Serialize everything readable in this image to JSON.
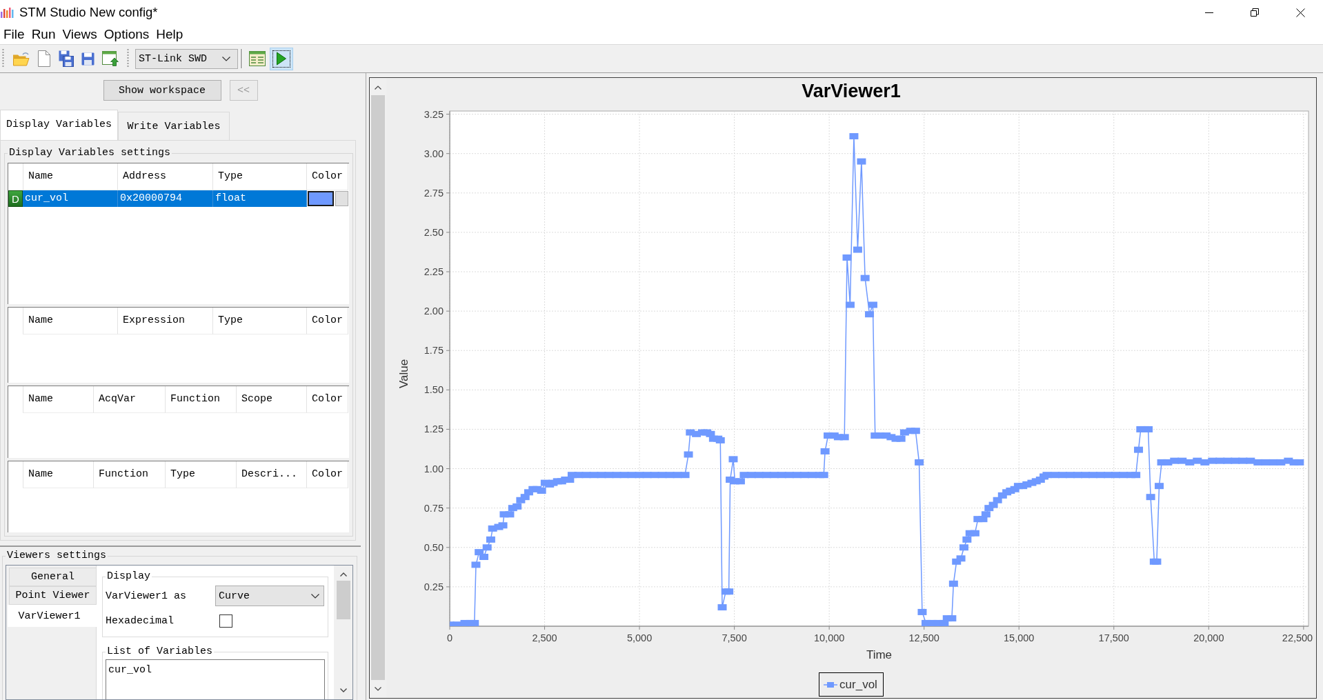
{
  "window": {
    "title": "STM Studio New config*"
  },
  "menu": [
    "File",
    "Run",
    "Views",
    "Options",
    "Help"
  ],
  "toolbar": {
    "connection": "ST-Link SWD",
    "run_focused": true
  },
  "workspace": {
    "show_button": {
      "label": "Show workspace",
      "disabled": false
    },
    "collapse_button": {
      "label": "<<",
      "disabled": true
    }
  },
  "tabs": [
    {
      "label": "Display Variables",
      "selected": true
    },
    {
      "label": "Write Variables",
      "selected": false
    }
  ],
  "display_settings": {
    "title": "Display Variables settings",
    "tables": [
      {
        "columns": [
          "Name",
          "Address",
          "Type",
          "Color"
        ],
        "rows": [
          {
            "flag": "D",
            "name": "cur_vol",
            "address": "0x20000794",
            "type": "float",
            "color": "#6f99ff",
            "selected": true
          }
        ]
      },
      {
        "columns": [
          "Name",
          "Expression",
          "Type",
          "Color"
        ]
      },
      {
        "columns": [
          "Name",
          "AcqVar",
          "Function",
          "Scope",
          "Color"
        ]
      },
      {
        "columns": [
          "Name",
          "Function",
          "Type",
          "Descri...",
          "Color"
        ]
      }
    ]
  },
  "viewers_settings": {
    "title": "Viewers settings",
    "tabs": [
      {
        "label": "General",
        "selected": false
      },
      {
        "label": "Point Viewer",
        "selected": false
      },
      {
        "label": "VarViewer1",
        "selected": true
      }
    ],
    "display": {
      "title": "Display",
      "as_label": "VarViewer1 as",
      "as_value": "Curve",
      "hex_label": "Hexadecimal",
      "hexadecimal": false
    },
    "variables": {
      "title": "List of Variables",
      "items": [
        "cur_vol"
      ]
    }
  },
  "viewer": {
    "chart_data": [
      {
        "type": "line",
        "title": "VarViewer1",
        "xlabel": "Time",
        "ylabel": "Value",
        "marker": "square",
        "grid": true,
        "legend": "bottom",
        "xlim": [
          0,
          22630
        ],
        "ylim": [
          0,
          3.27
        ],
        "xticks": [
          {
            "value": 0,
            "label": "0"
          },
          {
            "value": 2500,
            "label": "2,500"
          },
          {
            "value": 5000,
            "label": "5,000"
          },
          {
            "value": 7500,
            "label": "7,500"
          },
          {
            "value": 10000,
            "label": "10,000"
          },
          {
            "value": 12500,
            "label": "12,500"
          },
          {
            "value": 15000,
            "label": "15,000"
          },
          {
            "value": 17500,
            "label": "17,500"
          },
          {
            "value": 20000,
            "label": "20,000"
          },
          {
            "value": 22500,
            "label": "22,500"
          }
        ],
        "yticks": [
          {
            "value": 0.25,
            "label": "0.25"
          },
          {
            "value": 0.5,
            "label": "0.50"
          },
          {
            "value": 0.75,
            "label": "0.75"
          },
          {
            "value": 1,
            "label": "1.00"
          },
          {
            "value": 1.25,
            "label": "1.25"
          },
          {
            "value": 1.5,
            "label": "1.50"
          },
          {
            "value": 1.75,
            "label": "1.75"
          },
          {
            "value": 2,
            "label": "2.00"
          },
          {
            "value": 2.25,
            "label": "2.25"
          },
          {
            "value": 2.5,
            "label": "2.50"
          },
          {
            "value": 2.75,
            "label": "2.75"
          },
          {
            "value": 3,
            "label": "3.00"
          },
          {
            "value": 3.25,
            "label": "3.25"
          }
        ],
        "x": [
          0,
          200,
          400,
          550,
          650,
          690,
          775,
          900,
          985,
          1080,
          1130,
          1290,
          1400,
          1435,
          1580,
          1660,
          1775,
          1870,
          1985,
          2080,
          2195,
          2305,
          2420,
          2515,
          2630,
          2725,
          2840,
          2950,
          3050,
          3160,
          3225,
          3400,
          3600,
          3800,
          4000,
          4200,
          4400,
          4600,
          4800,
          5000,
          5200,
          5400,
          5600,
          5800,
          6000,
          6200,
          6290,
          6340,
          6500,
          6660,
          6775,
          6870,
          6950,
          7065,
          7130,
          7180,
          7275,
          7355,
          7390,
          7470,
          7515,
          7660,
          7760,
          7950,
          8150,
          8350,
          8550,
          8750,
          8950,
          9150,
          9350,
          9550,
          9750,
          9855,
          9890,
          9970,
          10130,
          10240,
          10400,
          10470,
          10550,
          10650,
          10750,
          10850,
          10945,
          11060,
          11150,
          11210,
          11340,
          11500,
          11630,
          11760,
          11890,
          11985,
          12145,
          12275,
          12370,
          12450,
          12550,
          12710,
          12870,
          13030,
          13110,
          13230,
          13275,
          13355,
          13470,
          13550,
          13630,
          13710,
          13840,
          13920,
          14050,
          14130,
          14210,
          14325,
          14435,
          14565,
          14680,
          14775,
          14890,
          14985,
          15100,
          15210,
          15340,
          15455,
          15565,
          15660,
          15740,
          15950,
          16150,
          16350,
          16550,
          16750,
          16950,
          17150,
          17350,
          17550,
          17750,
          17950,
          18080,
          18150,
          18210,
          18310,
          18405,
          18470,
          18565,
          18630,
          18695,
          18760,
          18920,
          19100,
          19300,
          19500,
          19700,
          19900,
          20100,
          20300,
          20500,
          20700,
          20900,
          21100,
          21300,
          21500,
          21700,
          21900,
          22100,
          22250,
          22390
        ],
        "series": [
          {
            "name": "cur_vol",
            "color": "#6f99ff",
            "values": [
              0.01,
              0.01,
              0.02,
              0.02,
              0.02,
              0.39,
              0.47,
              0.44,
              0.5,
              0.55,
              0.62,
              0.63,
              0.64,
              0.71,
              0.71,
              0.75,
              0.76,
              0.8,
              0.82,
              0.85,
              0.87,
              0.87,
              0.86,
              0.91,
              0.9,
              0.91,
              0.92,
              0.92,
              0.93,
              0.93,
              0.96,
              0.96,
              0.96,
              0.96,
              0.96,
              0.96,
              0.96,
              0.96,
              0.96,
              0.96,
              0.96,
              0.96,
              0.96,
              0.96,
              0.96,
              0.96,
              1.09,
              1.23,
              1.22,
              1.23,
              1.23,
              1.22,
              1.19,
              1.19,
              1.18,
              0.12,
              0.22,
              0.22,
              0.93,
              1.06,
              0.92,
              0.92,
              0.96,
              0.96,
              0.96,
              0.96,
              0.96,
              0.96,
              0.96,
              0.96,
              0.96,
              0.96,
              0.96,
              0.96,
              1.11,
              1.21,
              1.21,
              1.2,
              1.2,
              2.34,
              2.04,
              3.11,
              2.39,
              2.95,
              2.21,
              1.98,
              2.04,
              1.21,
              1.21,
              1.21,
              1.2,
              1.19,
              1.19,
              1.23,
              1.24,
              1.24,
              1.04,
              0.09,
              0.02,
              0.02,
              0.02,
              0.02,
              0.05,
              0.05,
              0.27,
              0.41,
              0.43,
              0.5,
              0.55,
              0.59,
              0.59,
              0.68,
              0.68,
              0.71,
              0.75,
              0.77,
              0.8,
              0.83,
              0.85,
              0.86,
              0.87,
              0.89,
              0.89,
              0.9,
              0.91,
              0.92,
              0.93,
              0.95,
              0.96,
              0.96,
              0.96,
              0.96,
              0.96,
              0.96,
              0.96,
              0.96,
              0.96,
              0.96,
              0.96,
              0.96,
              0.96,
              1.12,
              1.25,
              1.25,
              1.25,
              0.82,
              0.41,
              0.41,
              0.89,
              1.04,
              1.04,
              1.05,
              1.05,
              1.04,
              1.05,
              1.04,
              1.05,
              1.05,
              1.05,
              1.05,
              1.05,
              1.05,
              1.04,
              1.04,
              1.04,
              1.04,
              1.05,
              1.04,
              1.04
            ]
          }
        ]
      }
    ]
  }
}
